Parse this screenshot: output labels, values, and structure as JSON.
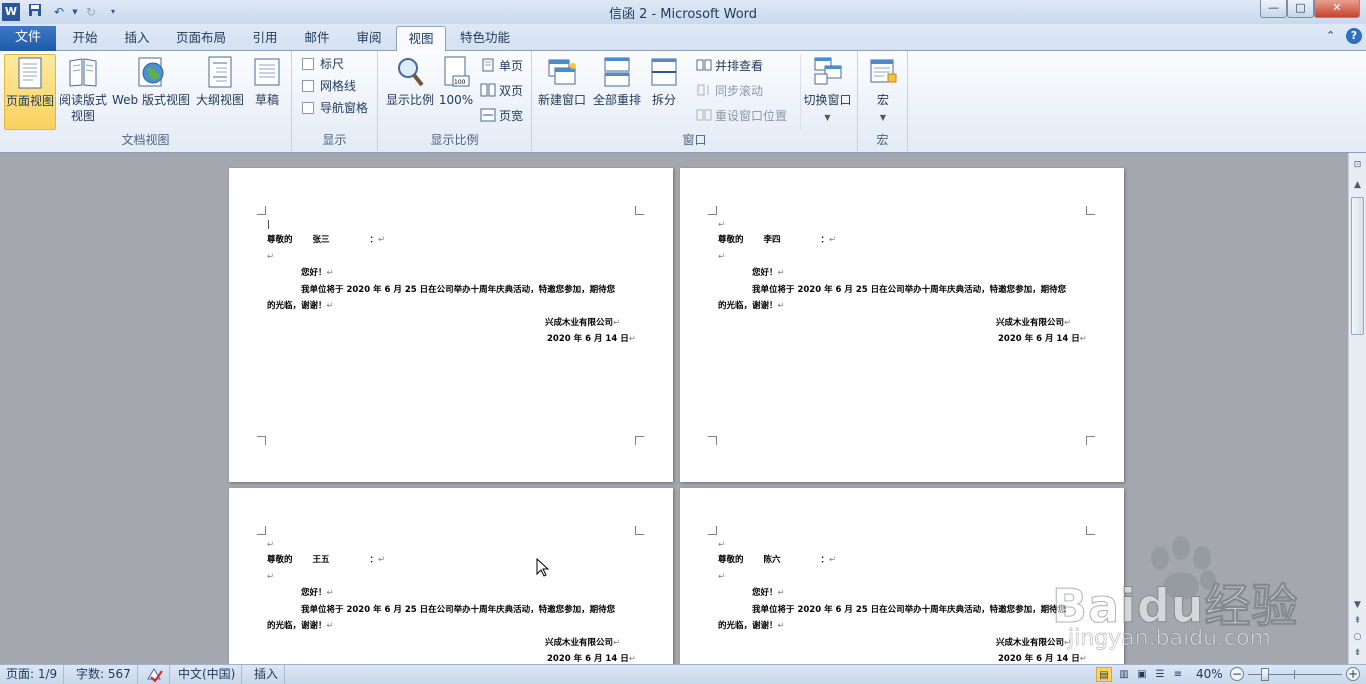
{
  "titlebar": {
    "title": "信函 2 - Microsoft Word",
    "window_buttons": {
      "minimize": "—",
      "maximize": "□",
      "close": "✕"
    }
  },
  "tabs": {
    "file": "文件",
    "items": [
      "开始",
      "插入",
      "页面布局",
      "引用",
      "邮件",
      "审阅",
      "视图",
      "特色功能"
    ],
    "active": "视图"
  },
  "ribbon": {
    "doc_views": {
      "label": "文档视图",
      "print_layout": "页面视图",
      "reading_line1": "阅读版式",
      "reading_line2": "视图",
      "web": "Web 版式视图",
      "outline": "大纲视图",
      "draft": "草稿"
    },
    "show": {
      "label": "显示",
      "ruler": "标尺",
      "gridlines": "网格线",
      "nav_pane": "导航窗格"
    },
    "zoom": {
      "label": "显示比例",
      "zoom": "显示比例",
      "hundred": "100%",
      "one_page": "单页",
      "two_pages": "双页",
      "page_width": "页宽"
    },
    "window": {
      "label": "窗口",
      "new_window": "新建窗口",
      "arrange_all": "全部重排",
      "split": "拆分",
      "side_by_side": "并排查看",
      "sync_scroll": "同步滚动",
      "reset_position": "重设窗口位置",
      "switch_windows": "切换窗口"
    },
    "macros": {
      "label": "宏",
      "macros": "宏"
    }
  },
  "letter": {
    "greeting_prefix": "尊敬的",
    "colon": "：",
    "hello": "您好！",
    "body_line1": "我单位将于 2020 年 6 月 25 日在公司举办十周年庆典活动，特邀您参加，期待您",
    "body_line2": "的光临，谢谢！",
    "company": "兴成木业有限公司",
    "date": "2020 年 6 月 14 日"
  },
  "pages": [
    {
      "recipient": "张三"
    },
    {
      "recipient": "李四"
    },
    {
      "recipient": "王五"
    },
    {
      "recipient": "陈六"
    }
  ],
  "statusbar": {
    "page": "页面: 1/9",
    "words": "字数: 567",
    "language": "中文(中国)",
    "mode": "插入",
    "zoom": "40%",
    "zoom_minus": "−",
    "zoom_plus": "+"
  },
  "watermark": {
    "brand": "Baidu经验",
    "url": "jingyan.baidu.com"
  },
  "colors": {
    "file_tab": "#2b6cb8",
    "selected_button": "#f9d25f",
    "page": "#ffffff",
    "doc_background": "#a4a8ae"
  }
}
